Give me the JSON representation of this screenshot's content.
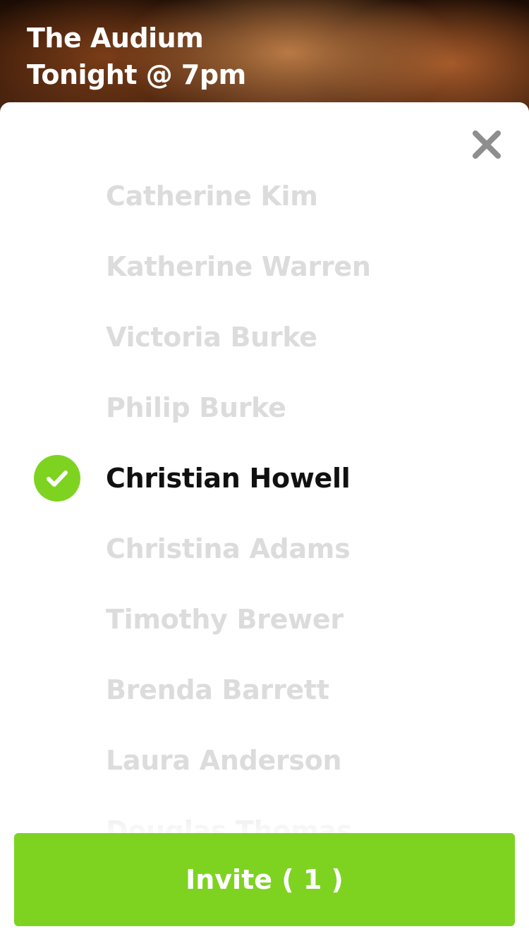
{
  "header": {
    "title_line1": "The Audium",
    "title_line2": "Tonight @ 7pm"
  },
  "icons": {
    "close": "close-icon",
    "selected_check": "checkmark-circle-icon"
  },
  "contacts": [
    {
      "name": "Catherine Kim",
      "selected": false
    },
    {
      "name": "Katherine Warren",
      "selected": false
    },
    {
      "name": "Victoria Burke",
      "selected": false
    },
    {
      "name": "Philip Burke",
      "selected": false
    },
    {
      "name": "Christian Howell",
      "selected": true
    },
    {
      "name": "Christina Adams",
      "selected": false
    },
    {
      "name": "Timothy Brewer",
      "selected": false
    },
    {
      "name": "Brenda Barrett",
      "selected": false
    },
    {
      "name": "Laura Anderson",
      "selected": false
    },
    {
      "name": "Douglas Thomas",
      "selected": false
    }
  ],
  "invite_button": {
    "label": "Invite ( 1 )"
  },
  "colors": {
    "accent": "#7ed321",
    "unselected_text": "#dcdcdc",
    "selected_text": "#111111",
    "close_icon": "#8e8e8e"
  }
}
